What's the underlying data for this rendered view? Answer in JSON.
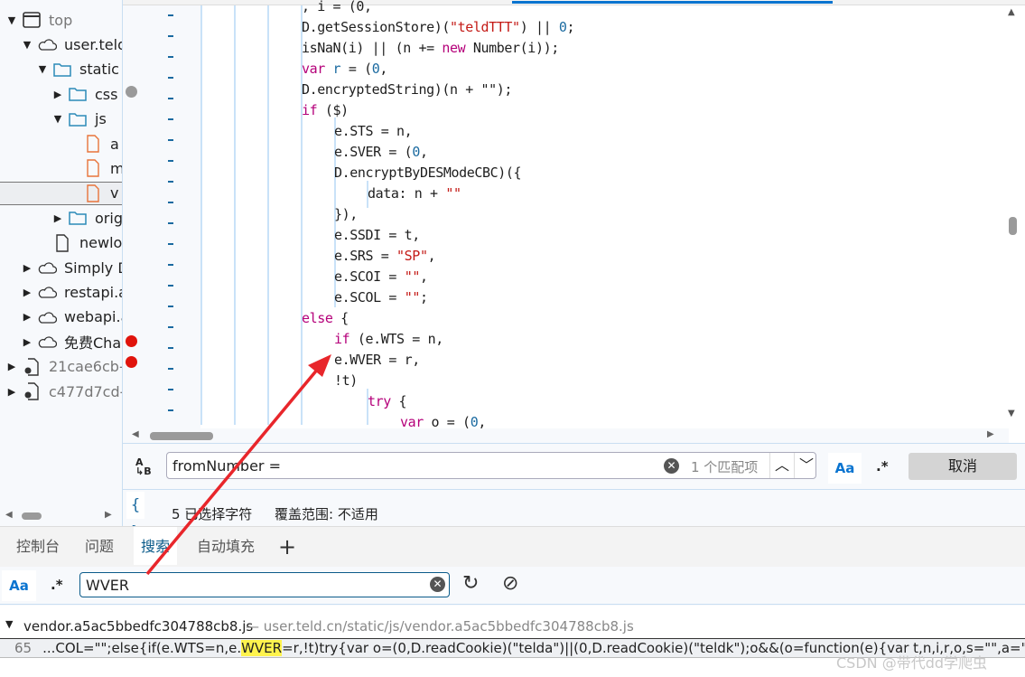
{
  "tree": [
    {
      "label": "top",
      "depth": 0,
      "expanded": true,
      "icon": "window-icon",
      "muted": true
    },
    {
      "label": "user.teld",
      "depth": 1,
      "expanded": true,
      "icon": "cloud-icon"
    },
    {
      "label": "static",
      "depth": 2,
      "expanded": true,
      "icon": "folder-icon"
    },
    {
      "label": "css",
      "depth": 3,
      "expanded": false,
      "icon": "folder-icon"
    },
    {
      "label": "js",
      "depth": 3,
      "expanded": true,
      "icon": "folder-icon"
    },
    {
      "label": "a",
      "depth": 4,
      "icon": "js-file-icon"
    },
    {
      "label": "m",
      "depth": 4,
      "icon": "js-file-icon"
    },
    {
      "label": "v",
      "depth": 4,
      "icon": "js-file-icon",
      "selected": true
    },
    {
      "label": "orig",
      "depth": 3,
      "expanded": false,
      "icon": "folder-icon"
    },
    {
      "label": "newlo",
      "depth": 2,
      "icon": "file-icon"
    },
    {
      "label": "Simply D",
      "depth": 1,
      "expanded": false,
      "icon": "cloud-icon"
    },
    {
      "label": "restapi.a",
      "depth": 1,
      "expanded": false,
      "icon": "cloud-icon"
    },
    {
      "label": "webapi.a",
      "depth": 1,
      "expanded": false,
      "icon": "cloud-icon"
    },
    {
      "label": "免费Cha",
      "depth": 1,
      "expanded": false,
      "icon": "cloud-icon"
    },
    {
      "label": "21cae6cb-",
      "depth": 0,
      "expanded": false,
      "icon": "extension-file-icon",
      "muted": true
    },
    {
      "label": "c477d7cd-",
      "depth": 0,
      "expanded": false,
      "icon": "extension-file-icon",
      "muted": true
    }
  ],
  "code_lines": [
    {
      "indent": 3,
      "tokens": [
        [
          "",
          ", i = (0,"
        ]
      ]
    },
    {
      "indent": 3,
      "tokens": [
        [
          "",
          "D.getSessionStore)("
        ],
        [
          "str",
          "\"teldTTT\""
        ],
        [
          "",
          ") || "
        ],
        [
          "num",
          "0"
        ],
        [
          "",
          ";"
        ]
      ]
    },
    {
      "indent": 3,
      "tokens": [
        [
          "",
          "isNaN(i) || (n += "
        ],
        [
          "kw",
          "new"
        ],
        [
          "",
          " Number(i));"
        ]
      ]
    },
    {
      "indent": 3,
      "tokens": [
        [
          "kw",
          "var"
        ],
        [
          "",
          " "
        ],
        [
          "var",
          "r"
        ],
        [
          "",
          " = ("
        ],
        [
          "num",
          "0"
        ],
        [
          "",
          ","
        ]
      ]
    },
    {
      "indent": 3,
      "tokens": [
        [
          "",
          "D.encryptedString)(n + \"\");"
        ]
      ]
    },
    {
      "indent": 3,
      "tokens": [
        [
          "kw",
          "if"
        ],
        [
          "",
          " ($)"
        ]
      ]
    },
    {
      "indent": 4,
      "tokens": [
        [
          "",
          "e.STS = n,"
        ]
      ]
    },
    {
      "indent": 4,
      "tokens": [
        [
          "",
          "e.SVER = ("
        ],
        [
          "num",
          "0"
        ],
        [
          "",
          ","
        ]
      ]
    },
    {
      "indent": 4,
      "tokens": [
        [
          "",
          "D.encryptByDESModeCBC)({"
        ]
      ]
    },
    {
      "indent": 5,
      "tokens": [
        [
          "",
          "data: n + "
        ],
        [
          "str",
          "\"\""
        ]
      ]
    },
    {
      "indent": 4,
      "tokens": [
        [
          "",
          "}),"
        ]
      ]
    },
    {
      "indent": 4,
      "tokens": [
        [
          "",
          "e.SSDI = t,"
        ]
      ]
    },
    {
      "indent": 4,
      "tokens": [
        [
          "",
          "e.SRS = "
        ],
        [
          "str",
          "\"SP\""
        ],
        [
          "",
          ","
        ]
      ]
    },
    {
      "indent": 4,
      "tokens": [
        [
          "",
          "e.SCOI = "
        ],
        [
          "str",
          "\"\""
        ],
        [
          "",
          ","
        ]
      ]
    },
    {
      "indent": 4,
      "tokens": [
        [
          "",
          "e.SCOL = "
        ],
        [
          "str",
          "\"\""
        ],
        [
          "",
          ";"
        ]
      ]
    },
    {
      "indent": 3,
      "tokens": [
        [
          "kw",
          "else"
        ],
        [
          "",
          " {"
        ]
      ]
    },
    {
      "indent": 4,
      "tokens": [
        [
          "kw",
          "if"
        ],
        [
          "",
          " (e.WTS = n,"
        ]
      ]
    },
    {
      "indent": 4,
      "tokens": [
        [
          "",
          "e.WVER = r,"
        ]
      ]
    },
    {
      "indent": 4,
      "tokens": [
        [
          "",
          "!t)"
        ]
      ]
    },
    {
      "indent": 5,
      "tokens": [
        [
          "kw",
          "try"
        ],
        [
          "",
          " {"
        ]
      ]
    },
    {
      "indent": 6,
      "tokens": [
        [
          "kw",
          "var"
        ],
        [
          "",
          " o = ("
        ],
        [
          "num",
          "0"
        ],
        [
          "",
          ","
        ]
      ]
    }
  ],
  "breakpoints": [
    {
      "line": 4,
      "type": "inactive"
    },
    {
      "line": 16,
      "type": "active"
    },
    {
      "line": 17,
      "type": "active"
    }
  ],
  "find": {
    "value": "fromNumber =",
    "match_count": "1 个匹配项",
    "case_label": "Aa",
    "regex_label": ".*",
    "cancel_label": "取消"
  },
  "status": {
    "selection": "5 已选择字符",
    "coverage": "覆盖范围: 不适用"
  },
  "drawer_tabs": [
    {
      "label": "控制台"
    },
    {
      "label": "问题"
    },
    {
      "label": "搜索",
      "active": true
    },
    {
      "label": "自动填充"
    }
  ],
  "search": {
    "case_label": "Aa",
    "regex_label": ".*",
    "value": "WVER"
  },
  "results": {
    "file": "vendor.a5ac5bbedfc304788cb8.js",
    "path": "— user.teld.cn/static/js/vendor.a5ac5bbedfc304788cb8.js",
    "line_number": "65",
    "before": "...COL=\"\";else{if(e.WTS=n,e.",
    "match": "WVER",
    "after": "=r,!t)try{var o=(0,D.readCookie)(\"telda\")||(0,D.readCookie)(\"teldk\");o&&(o=function(e){var t,n,i,r,o,s=\"\",a=\"\",l=\"\",u=\"Al"
  },
  "watermark": "CSDN @带代dd学爬虫",
  "colors": {
    "accent": "#0a74d0",
    "breakpoint": "#e0140c",
    "highlight": "#fff34d",
    "arrow": "#e8262b"
  }
}
